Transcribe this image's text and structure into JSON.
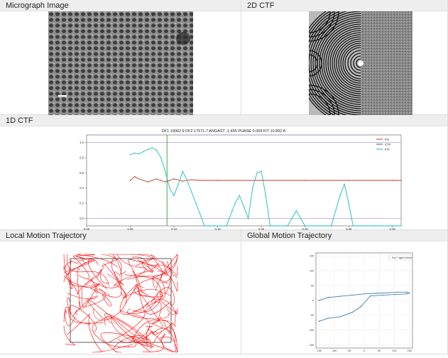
{
  "panels": {
    "micrograph": {
      "title": "Micrograph Image"
    },
    "ctf2d": {
      "title": "2D CTF"
    },
    "ctf1d": {
      "title": "1D CTF"
    },
    "local_motion": {
      "title": "Local Motion Trajectory"
    },
    "global_motion": {
      "title": "Global Motion Trajectory"
    }
  },
  "colors": {
    "ps": "#c0392b",
    "ctf": "#555555",
    "fit": "#1abcbc",
    "trajectory": "#ff0000",
    "global": "#2c6fa8"
  },
  "chart_data": [
    {
      "type": "line",
      "title": "DF1 19062.9 DF2 17571.7 ANGAST -1.455 PHASE 0.009 FIT 10.892 A",
      "xlim": [
        0.0,
        0.36
      ],
      "ylim": [
        -0.1,
        1.1
      ],
      "xticks": [
        "0.00",
        "0.05",
        "0.10",
        "0.15",
        "0.20",
        "0.25",
        "0.30",
        "0.35"
      ],
      "yticks": [
        "0.0",
        "0.2",
        "0.4",
        "0.6",
        "0.8",
        "1.0"
      ],
      "legend": [
        "PS",
        "CTF",
        "FIT"
      ],
      "legend_position": "top-right",
      "fit_resolution_marker": 0.092,
      "series": [
        {
          "name": "PS",
          "x": [
            0.05,
            0.055,
            0.06,
            0.065,
            0.07,
            0.075,
            0.08,
            0.085,
            0.09,
            0.095,
            0.1,
            0.11,
            0.12,
            0.13,
            0.15,
            0.2,
            0.25,
            0.3,
            0.35,
            0.36
          ],
          "y": [
            0.5,
            0.55,
            0.52,
            0.5,
            0.48,
            0.5,
            0.52,
            0.5,
            0.48,
            0.5,
            0.52,
            0.49,
            0.51,
            0.5,
            0.5,
            0.5,
            0.5,
            0.5,
            0.5,
            0.5
          ]
        },
        {
          "name": "FIT",
          "x": [
            0.05,
            0.055,
            0.06,
            0.065,
            0.07,
            0.075,
            0.08,
            0.085,
            0.09,
            0.095,
            0.1,
            0.105,
            0.11,
            0.115,
            0.12,
            0.125,
            0.13,
            0.135,
            0.14,
            0.145,
            0.15,
            0.16,
            0.17,
            0.175,
            0.18,
            0.185,
            0.19,
            0.195,
            0.2,
            0.205,
            0.21,
            0.22,
            0.23,
            0.235,
            0.24,
            0.245,
            0.25,
            0.26,
            0.27,
            0.28,
            0.29,
            0.295,
            0.3,
            0.305,
            0.31,
            0.32,
            0.33,
            0.34,
            0.35,
            0.36
          ],
          "y": [
            0.84,
            0.86,
            0.85,
            0.88,
            0.91,
            0.93,
            0.9,
            0.8,
            0.62,
            0.4,
            0.3,
            0.45,
            0.62,
            0.5,
            0.35,
            0.2,
            0.05,
            -0.1,
            -0.1,
            -0.1,
            -0.1,
            -0.1,
            0.2,
            0.3,
            0.15,
            0.0,
            0.4,
            0.6,
            0.62,
            0.3,
            -0.1,
            -0.1,
            -0.1,
            0.0,
            0.1,
            0.0,
            -0.1,
            -0.1,
            -0.1,
            -0.1,
            0.3,
            0.45,
            0.2,
            -0.1,
            -0.1,
            -0.1,
            -0.1,
            -0.1,
            -0.1,
            -0.1
          ]
        }
      ]
    },
    {
      "type": "line",
      "title": "",
      "legend": [
        "Full + tgsd motion"
      ],
      "legend_position": "top-right",
      "xticks": [
        "-150",
        "-100",
        "-50",
        "0",
        "50",
        "100",
        "150"
      ],
      "yticks": [
        "150",
        "100",
        "50",
        "0",
        "-50",
        "-100",
        "-150"
      ],
      "xlim": [
        -160,
        160
      ],
      "ylim": [
        -160,
        160
      ],
      "series": [
        {
          "name": "Full + tgsd motion",
          "x": [
            -150,
            -120,
            -80,
            -40,
            0,
            40,
            80,
            110,
            140,
            150,
            140,
            100,
            60,
            20,
            -10,
            -40,
            -80,
            -120,
            -150
          ],
          "y": [
            0,
            10,
            14,
            18,
            22,
            24,
            26,
            28,
            28,
            25,
            22,
            20,
            18,
            15,
            -20,
            -40,
            -55,
            -60,
            -70
          ]
        }
      ]
    }
  ]
}
